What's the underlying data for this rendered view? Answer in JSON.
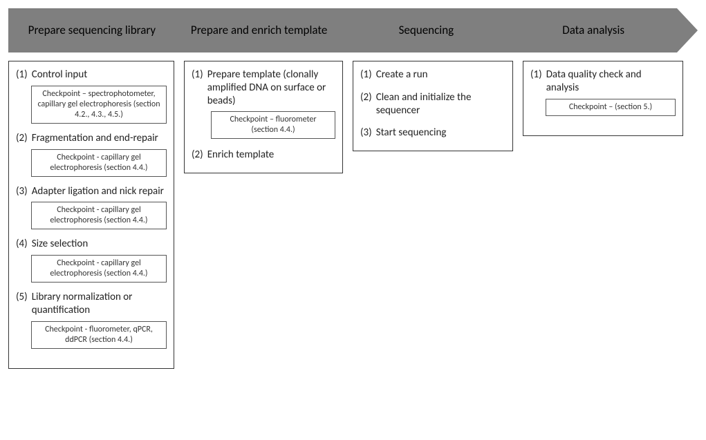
{
  "phases": [
    {
      "title": "Prepare sequencing library"
    },
    {
      "title": "Prepare and enrich template"
    },
    {
      "title": "Sequencing"
    },
    {
      "title": "Data analysis"
    }
  ],
  "columns": [
    {
      "steps": [
        {
          "num": "(1)",
          "text": "Control input",
          "checkpoint": "Checkpoint – spectrophotometer, capillary gel electrophoresis (section 4.2., 4.3., 4.5.)"
        },
        {
          "num": "(2)",
          "text": "Fragmentation and end-repair",
          "checkpoint": "Checkpoint - capillary gel electrophoresis (section 4.4.)"
        },
        {
          "num": "(3)",
          "text": "Adapter ligation and nick repair",
          "checkpoint": "Checkpoint - capillary gel electrophoresis (section 4.4.)"
        },
        {
          "num": "(4)",
          "text": "Size selection",
          "checkpoint": "Checkpoint - capillary gel electrophoresis (section 4.4.)"
        },
        {
          "num": "(5)",
          "text": "Library normalization or quantification",
          "checkpoint": "Checkpoint - fluorometer, qPCR, ddPCR (section 4.4.)"
        }
      ]
    },
    {
      "steps": [
        {
          "num": "(1)",
          "text": "Prepare template (clonally amplified DNA on surface or beads)",
          "checkpoint": "Checkpoint – fluorometer (section 4.4.)"
        },
        {
          "num": "(2)",
          "text": "Enrich template"
        }
      ]
    },
    {
      "steps": [
        {
          "num": "(1)",
          "text": "Create a run"
        },
        {
          "num": "(2)",
          "text": "Clean and initialize the sequencer"
        },
        {
          "num": "(3)",
          "text": "Start sequencing"
        }
      ]
    },
    {
      "steps": [
        {
          "num": "(1)",
          "text": "Data quality check and analysis",
          "checkpoint": "Checkpoint – (section 5.)"
        }
      ]
    }
  ]
}
